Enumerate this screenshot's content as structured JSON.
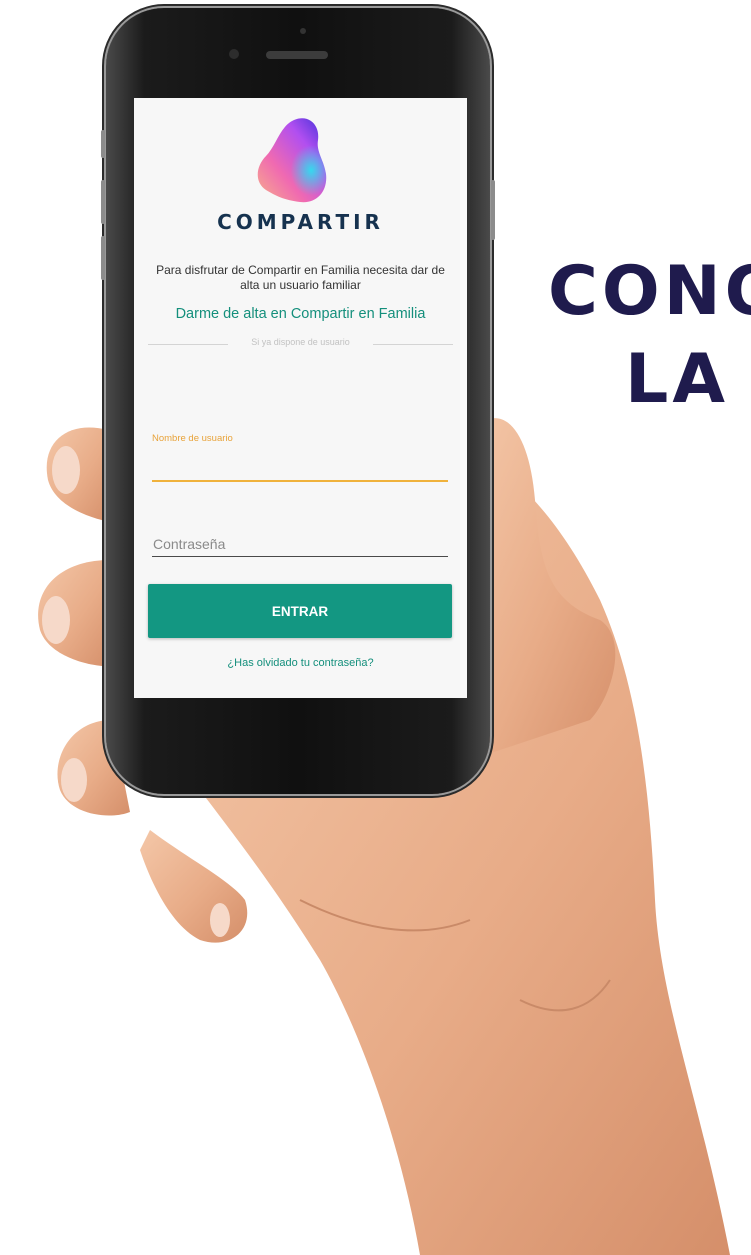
{
  "headline": {
    "line1": "CONO",
    "line2": "LA"
  },
  "app": {
    "brand_name": "COMPARTIR",
    "info_text": "Para disfrutar de Compartir en Familia necesita dar de alta un usuario familiar",
    "signup_link": "Darme de alta en Compartir en Familia",
    "divider_label": "Si ya dispone de usuario",
    "username_label": "Nombre de usuario",
    "username_value": "",
    "password_placeholder": "Contraseña",
    "submit_label": "ENTRAR",
    "forgot_link": "¿Has olvidado tu contraseña?"
  },
  "colors": {
    "headline": "#1f1b4d",
    "brand_text": "#16324f",
    "accent_teal": "#139782",
    "focus_orange": "#f0b23c",
    "screen_background": "#f7f7f7"
  },
  "icons": {
    "logo": "compartir-logo-blob"
  }
}
